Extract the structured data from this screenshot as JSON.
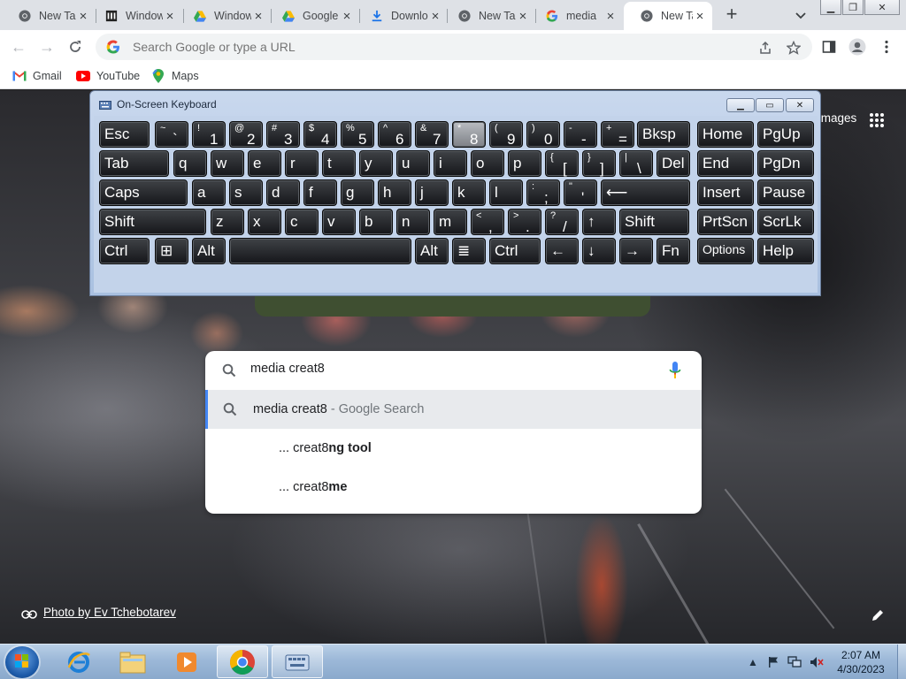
{
  "browser": {
    "tabs": [
      {
        "title": "New Tab",
        "icon": "chrome-icon"
      },
      {
        "title": "Windows",
        "icon": "museum-icon"
      },
      {
        "title": "Windows",
        "icon": "drive-icon"
      },
      {
        "title": "Google",
        "icon": "drive-icon"
      },
      {
        "title": "Downloads",
        "icon": "download-icon"
      },
      {
        "title": "New Tab",
        "icon": "chrome-icon"
      },
      {
        "title": "media",
        "icon": "google-icon"
      },
      {
        "title": "New Tab",
        "icon": "chrome-icon",
        "active": true
      }
    ],
    "omnibox_placeholder": "Search Google or type a URL",
    "bookmarks": [
      {
        "label": "Gmail",
        "icon": "gmail-icon"
      },
      {
        "label": "YouTube",
        "icon": "youtube-icon"
      },
      {
        "label": "Maps",
        "icon": "maps-icon"
      }
    ]
  },
  "newtab": {
    "images_link": "Images",
    "search_query": "media creat8",
    "suggestions": [
      {
        "text": "media creat8",
        "suffix": " - Google Search",
        "selected": true
      },
      {
        "prefix": "... creat8",
        "bold": "ng tool"
      },
      {
        "prefix": "... creat8",
        "bold": "me"
      }
    ],
    "photo_credit": "Photo by Ev Tchebotarev"
  },
  "osk": {
    "title": "On-Screen Keyboard",
    "rows": [
      [
        {
          "main": "Esc"
        },
        {
          "sh": "~",
          "lo": "`"
        },
        {
          "sh": "!",
          "lo": "1"
        },
        {
          "sh": "@",
          "lo": "2"
        },
        {
          "sh": "#",
          "lo": "3"
        },
        {
          "sh": "$",
          "lo": "4"
        },
        {
          "sh": "%",
          "lo": "5"
        },
        {
          "sh": "^",
          "lo": "6"
        },
        {
          "sh": "&",
          "lo": "7"
        },
        {
          "sh": "*",
          "lo": "8",
          "pressed": true
        },
        {
          "sh": "(",
          "lo": "9"
        },
        {
          "sh": ")",
          "lo": "0"
        },
        {
          "sh": "-",
          "lo": "-"
        },
        {
          "sh": "+",
          "lo": "="
        },
        {
          "main": "Bksp"
        },
        {
          "main": "Home"
        },
        {
          "main": "PgUp"
        }
      ],
      [
        {
          "main": "Tab"
        },
        {
          "main": "q"
        },
        {
          "main": "w"
        },
        {
          "main": "e"
        },
        {
          "main": "r"
        },
        {
          "main": "t"
        },
        {
          "main": "y"
        },
        {
          "main": "u"
        },
        {
          "main": "i"
        },
        {
          "main": "o"
        },
        {
          "main": "p"
        },
        {
          "sh": "{",
          "lo": "["
        },
        {
          "sh": "}",
          "lo": "]"
        },
        {
          "sh": "|",
          "lo": "\\"
        },
        {
          "main": "Del"
        },
        {
          "main": "End"
        },
        {
          "main": "PgDn"
        }
      ],
      [
        {
          "main": "Caps"
        },
        {
          "main": "a"
        },
        {
          "main": "s"
        },
        {
          "main": "d"
        },
        {
          "main": "f"
        },
        {
          "main": "g"
        },
        {
          "main": "h"
        },
        {
          "main": "j"
        },
        {
          "main": "k"
        },
        {
          "main": "l"
        },
        {
          "sh": ":",
          "lo": ";"
        },
        {
          "sh": "\"",
          "lo": "'"
        },
        {
          "main": "⟵"
        },
        {
          "main": "Insert"
        },
        {
          "main": "Pause"
        }
      ],
      [
        {
          "main": "Shift"
        },
        {
          "main": "z"
        },
        {
          "main": "x"
        },
        {
          "main": "c"
        },
        {
          "main": "v"
        },
        {
          "main": "b"
        },
        {
          "main": "n"
        },
        {
          "main": "m"
        },
        {
          "sh": "<",
          "lo": ","
        },
        {
          "sh": ">",
          "lo": "."
        },
        {
          "sh": "?",
          "lo": "/"
        },
        {
          "main": "↑"
        },
        {
          "main": "Shift"
        },
        {
          "main": "PrtScn"
        },
        {
          "main": "ScrLk"
        }
      ],
      [
        {
          "main": "Ctrl"
        },
        {
          "main": "⊞"
        },
        {
          "main": "Alt"
        },
        {
          "main": ""
        },
        {
          "main": "Alt"
        },
        {
          "main": "≣"
        },
        {
          "main": "Ctrl"
        },
        {
          "main": "←"
        },
        {
          "main": "↓"
        },
        {
          "main": "→"
        },
        {
          "main": "Fn"
        },
        {
          "main": "Options"
        },
        {
          "main": "Help"
        }
      ]
    ]
  },
  "taskbar": {
    "apps": [
      "ie-icon",
      "explorer-folder-icon",
      "media-player-icon",
      "chrome-icon",
      "osk-icon"
    ],
    "time": "2:07 AM",
    "date": "4/30/2023"
  }
}
